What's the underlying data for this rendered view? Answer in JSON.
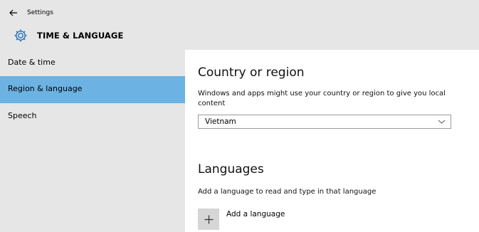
{
  "window": {
    "app_title": "Settings",
    "section_title": "TIME & LANGUAGE"
  },
  "icons": {
    "back": "back-arrow-icon",
    "section": "gear-icon",
    "dropdown": "chevron-down-icon",
    "add": "plus-icon"
  },
  "colors": {
    "chrome_background": "#e6e6e6",
    "selected_item": "#6cb2e3",
    "accent_icon": "#1f6fb8"
  },
  "sidebar": {
    "items": [
      {
        "label": "Date & time",
        "selected": false
      },
      {
        "label": "Region & language",
        "selected": true
      },
      {
        "label": "Speech",
        "selected": false
      }
    ]
  },
  "main": {
    "country": {
      "heading": "Country or region",
      "description": "Windows and apps might use your country or region to give you local content",
      "selected_value": "Vietnam"
    },
    "languages": {
      "heading": "Languages",
      "description": "Add a language to read and type in that language",
      "add_label": "Add a language"
    }
  }
}
